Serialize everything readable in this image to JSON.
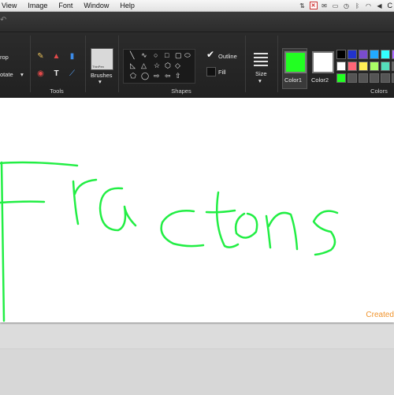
{
  "menubar": {
    "items": [
      "View",
      "Image",
      "Font",
      "Window",
      "Help"
    ],
    "status_icons": [
      "scroll-icon",
      "close-badge-icon",
      "mail-icon",
      "airplay-icon",
      "timemachine-icon",
      "bluetooth-icon",
      "wifi-icon",
      "volume-icon"
    ],
    "clock_text": "C"
  },
  "ribbon": {
    "crop_label": "rop",
    "rotate_label": "otate",
    "tools_label": "Tools",
    "thinpen_label": "ThinPen",
    "brushes_label": "Brushes",
    "shapes_label": "Shapes",
    "outline_label": "Outline",
    "fill_label": "Fill",
    "size_label": "Size",
    "color1_label": "Color1",
    "color2_label": "Color2",
    "colors_label": "Colors",
    "color1_hex": "#22ff22",
    "color2_hex": "#ffffff",
    "palette": [
      [
        "#000000",
        "#2233cc",
        "#7a4ccc",
        "#22aaff",
        "#33ffff",
        "#aa66ff"
      ],
      [
        "#ffffff",
        "#ff6677",
        "#ffee55",
        "#aaff66",
        "#55ddbb",
        "#666666"
      ],
      [
        "#22ff22",
        "#555555",
        "#555555",
        "#555555",
        "#555555",
        "#555555"
      ]
    ]
  },
  "canvas": {
    "handwriting": "Fractons",
    "ink_color": "#22ee44",
    "watermark": "Created"
  }
}
